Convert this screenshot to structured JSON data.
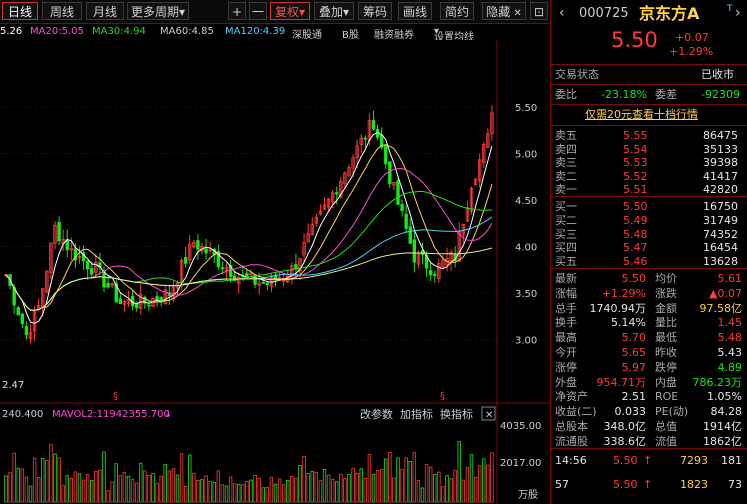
{
  "toolbar": {
    "daily": "日线",
    "weekly": "周线",
    "monthly": "月线",
    "more_periods": "更多周期",
    "zoom_in": "+",
    "zoom_out": "一",
    "adjust": "复权",
    "overlay": "叠加",
    "chips": "筹码",
    "draw": "画线",
    "brief": "简约",
    "hide": "隐藏"
  },
  "ma_line": {
    "ma5": "5.26",
    "ma20": "MA20:5.05",
    "ma30": "MA30:4.94",
    "ma60": "MA60:4.85",
    "ma120": "MA120:4.39",
    "sh_hk": "深股通",
    "b_share": "B股",
    "margin": "融资融券",
    "settings": "设置均线"
  },
  "price_axis": [
    "5.50",
    "5.00",
    "4.50",
    "4.00",
    "3.50",
    "3.00"
  ],
  "low_marker": "2.47",
  "volume_bar": {
    "a": "240.400",
    "b": "MAVOL2:11942355.700",
    "change_param": "改参数",
    "add_ind": "加指标",
    "switch_ind": "换指标"
  },
  "volume_axis": [
    "4035.00",
    "2017.00",
    "万股"
  ],
  "colors": {
    "up": "#ff3b3b",
    "down": "#19e619",
    "ma5": "#ffffff",
    "ma10": "#ffd24a",
    "ma20": "#ff4dd8",
    "ma30": "#19e619",
    "ma60": "#4ad2ff",
    "ma120": "#f0e68c"
  },
  "stock": {
    "code": "000725",
    "name": "京东方A",
    "marker": "T",
    "price": "5.50",
    "change": "+0.07",
    "pct": "+1.29%"
  },
  "status": {
    "label": "交易状态",
    "value": "已收市"
  },
  "ratio": {
    "label1": "委比",
    "value1": "-23.18%",
    "label2": "委差",
    "value2": "-92309"
  },
  "promo": "仅需20元查看十档行情",
  "asks": [
    {
      "label": "卖五",
      "price": "5.55",
      "vol": "86475"
    },
    {
      "label": "卖四",
      "price": "5.54",
      "vol": "35133"
    },
    {
      "label": "卖三",
      "price": "5.53",
      "vol": "39398"
    },
    {
      "label": "卖二",
      "price": "5.52",
      "vol": "41417"
    },
    {
      "label": "卖一",
      "price": "5.51",
      "vol": "42820"
    }
  ],
  "bids": [
    {
      "label": "买一",
      "price": "5.50",
      "vol": "16750"
    },
    {
      "label": "买二",
      "price": "5.49",
      "vol": "31749"
    },
    {
      "label": "买三",
      "price": "5.48",
      "vol": "74352"
    },
    {
      "label": "买四",
      "price": "5.47",
      "vol": "16454"
    },
    {
      "label": "买五",
      "price": "5.46",
      "vol": "13628"
    }
  ],
  "stats": [
    {
      "l1": "最新",
      "v1": "5.50",
      "c1": "red",
      "l2": "均价",
      "v2": "5.61",
      "c2": "red"
    },
    {
      "l1": "涨幅",
      "v1": "+1.29%",
      "c1": "red",
      "l2": "涨跌",
      "v2": "▲0.07",
      "c2": "red"
    },
    {
      "l1": "总手",
      "v1": "1740.94万",
      "c1": "wht",
      "l2": "金额",
      "v2": "97.58亿",
      "c2": "yel"
    },
    {
      "l1": "换手",
      "v1": "5.14%",
      "c1": "wht",
      "l2": "量比",
      "v2": "1.45",
      "c2": "red"
    },
    {
      "l1": "最高",
      "v1": "5.70",
      "c1": "red",
      "l2": "最低",
      "v2": "5.48",
      "c2": "red"
    },
    {
      "l1": "今开",
      "v1": "5.65",
      "c1": "red",
      "l2": "昨收",
      "v2": "5.43",
      "c2": "wht"
    },
    {
      "l1": "涨停",
      "v1": "5.97",
      "c1": "red",
      "l2": "跌停",
      "v2": "4.89",
      "c2": "grn"
    },
    {
      "l1": "外盘",
      "v1": "954.71万",
      "c1": "red",
      "l2": "内盘",
      "v2": "786.23万",
      "c2": "grn"
    },
    {
      "l1": "净资产",
      "v1": "2.51",
      "c1": "wht",
      "l2": "ROE",
      "v2": "1.05%",
      "c2": "wht"
    },
    {
      "l1": "收益(二)",
      "v1": "0.033",
      "c1": "wht",
      "l2": "PE(动)",
      "v2": "84.28",
      "c2": "wht"
    },
    {
      "l1": "总股本",
      "v1": "348.0亿",
      "c1": "wht",
      "l2": "总值",
      "v2": "1914亿",
      "c2": "wht"
    },
    {
      "l1": "流通股",
      "v1": "338.6亿",
      "c1": "wht",
      "l2": "流值",
      "v2": "1862亿",
      "c2": "wht"
    }
  ],
  "ticks": [
    {
      "time": "14:56",
      "price": "5.50",
      "arrow": "↑",
      "vol": "7293",
      "n": "181"
    },
    {
      "time": "57",
      "price": "5.50",
      "arrow": "↑",
      "vol": "1823",
      "n": "73"
    }
  ]
}
